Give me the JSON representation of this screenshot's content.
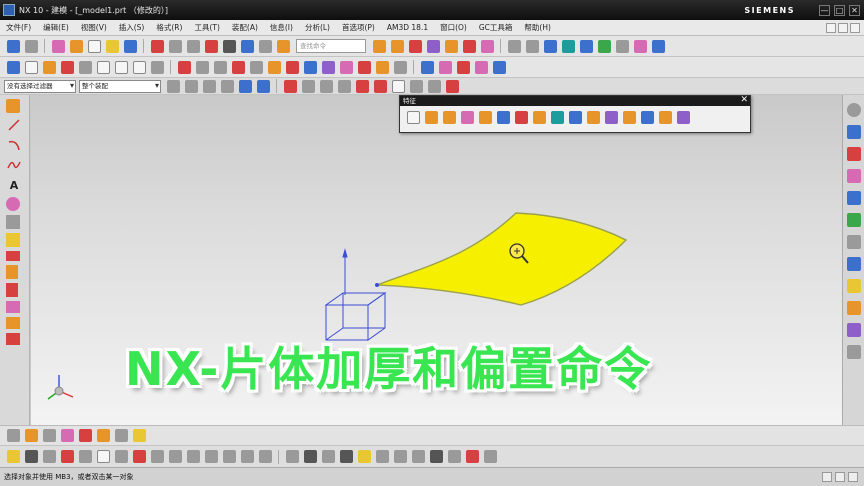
{
  "window": {
    "title": "NX 10 - 建模 - [_model1.prt （修改的）]",
    "brand": "SIEMENS",
    "controls": [
      "—",
      "□",
      "✕"
    ]
  },
  "menu": {
    "items": [
      "文件(F)",
      "编辑(E)",
      "视图(V)",
      "插入(S)",
      "格式(R)",
      "工具(T)",
      "装配(A)",
      "信息(I)",
      "分析(L)",
      "首选项(P)",
      "AM3D 18.1",
      "窗口(O)",
      "GC工具箱",
      "帮助(H)"
    ]
  },
  "toolbar": {
    "command_search_placeholder": "查找命令",
    "filter_type_value": "没有选择过滤器",
    "filter_scope_value": "整个装配"
  },
  "feature_toolbar": {
    "title": "特征",
    "close_glyph": "✕"
  },
  "overlay": {
    "title": "NX-片体加厚和偏置命令"
  },
  "status": {
    "prompt": "选择对象并使用 MB3，或者双击某一对象"
  },
  "left_tools": {
    "text_tool_glyph": "A"
  },
  "colors": {
    "surface_fill": "#f6f000",
    "surface_edge": "#9aa050",
    "wcs_color": "#3b4cd6",
    "overlay_text": "#39e651"
  }
}
